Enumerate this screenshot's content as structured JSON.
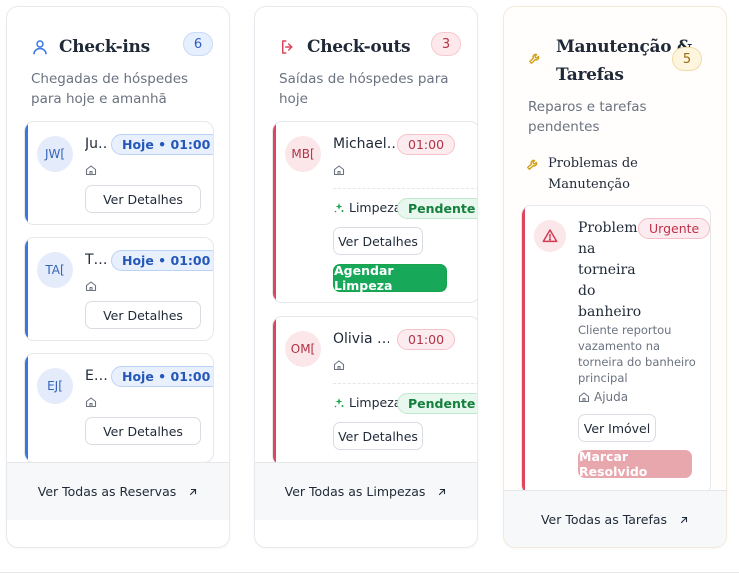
{
  "checkins": {
    "title": "Check-ins",
    "count": "6",
    "subtitle": "Chegadas de hóspedes para hoje e amanhã",
    "items": [
      {
        "initials": "JW[",
        "name": "Ju…",
        "badge": "Hoje • 01:00",
        "button": "Ver Detalhes"
      },
      {
        "initials": "TA[",
        "name": "T…",
        "badge": "Hoje • 01:00",
        "button": "Ver Detalhes"
      },
      {
        "initials": "EJ[",
        "name": "E…",
        "badge": "Hoje • 01:00",
        "button": "Ver Detalhes"
      }
    ],
    "footer": "Ver Todas as Reservas"
  },
  "checkouts": {
    "title": "Check-outs",
    "count": "3",
    "subtitle": "Saídas de hóspedes para hoje",
    "items": [
      {
        "initials": "MB[",
        "name": "Michael…",
        "time": "01:00",
        "cleaning_label": "Limpeza",
        "cleaning_status": "Pendente",
        "details_button": "Ver Detalhes",
        "schedule_button": "Agendar Limpeza"
      },
      {
        "initials": "OM[",
        "name": "Olivia …",
        "time": "01:00",
        "cleaning_label": "Limpeza",
        "cleaning_status": "Pendente",
        "details_button": "Ver Detalhes"
      }
    ],
    "footer": "Ver Todas as Limpezas"
  },
  "maintenance": {
    "title_line1": "Manutenção &",
    "title_line2": "Tarefas",
    "count": "5",
    "subtitle": "Reparos e tarefas pendentes",
    "section_title_line1": "Problemas de",
    "section_title_line2": "Manutenção",
    "issue": {
      "title_lines": [
        "Problema",
        "na",
        "torneira",
        "do",
        "banheiro"
      ],
      "priority": "Urgente",
      "description_lines": [
        "Cliente reportou",
        "vazamento na",
        "torneira do banheiro",
        "principal"
      ],
      "property": "Ajuda",
      "view_button": "Ver Imóvel",
      "resolve_button": "Marcar Resolvido"
    },
    "footer": "Ver Todas as Tarefas"
  },
  "colors": {
    "checkin_accent": "#3b76e4",
    "checkout_accent": "#e0445c",
    "maintenance_accent": "#d4a017",
    "success": "#18a85a"
  },
  "icons": {
    "checkins": "user-icon",
    "checkouts": "log-out-icon",
    "maintenance": "wrench-icon",
    "item_property": "home-icon",
    "cleaning": "sparkles-icon",
    "issue": "alert-triangle-icon",
    "footer": "arrow-up-right-icon"
  }
}
